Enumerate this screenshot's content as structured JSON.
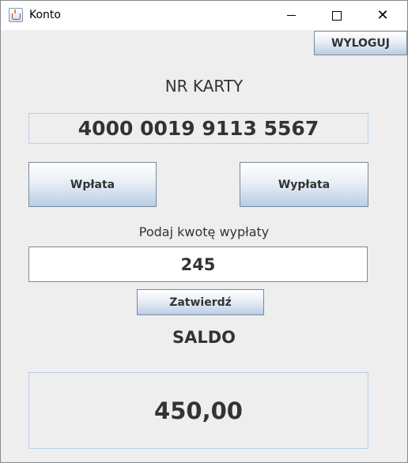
{
  "window": {
    "title": "Konto",
    "icon": "java-app-icon",
    "controls": [
      "minimize-icon",
      "maximize-icon",
      "close-icon"
    ]
  },
  "header": {
    "logout_label": "WYLOGUJ"
  },
  "card": {
    "label": "NR KARTY",
    "number": "4000 0019 9113 5567"
  },
  "actions": {
    "deposit_label": "Wpłata",
    "withdraw_label": "Wypłata"
  },
  "amount": {
    "prompt": "Podaj kwotę wypłaty",
    "value": "245",
    "confirm_label": "Zatwierdź"
  },
  "balance": {
    "label": "SALDO",
    "value": "450,00"
  },
  "colors": {
    "background": "#eeeeee",
    "text": "#333333",
    "field_border": "#b8cfe5",
    "button_gradient_bottom": "#b9cde3"
  }
}
